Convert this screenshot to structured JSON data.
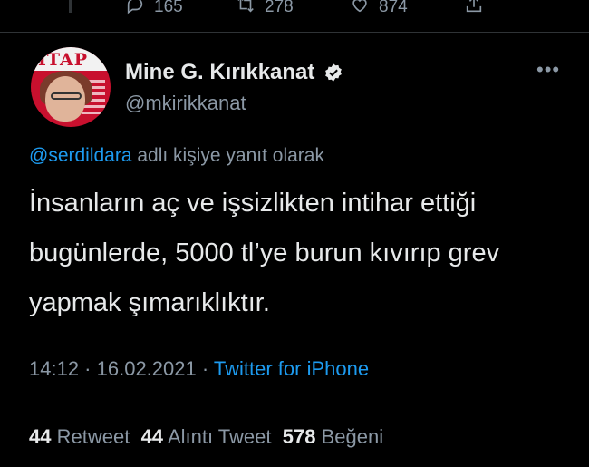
{
  "previous_tweet_actions": {
    "replies": "165",
    "retweets": "278",
    "likes": "874"
  },
  "author": {
    "avatar_banner_text": "ITAP",
    "name": "Mine G. Kırıkkanat",
    "handle": "@mkirikkanat"
  },
  "reply_context": {
    "mention": "@serdildara",
    "suffix": " adlı kişiye yanıt olarak"
  },
  "tweet": {
    "text": "İnsanların aç ve işsizlikten intihar ettiği bugünlerde, 5000 tl’ye burun kıvırıp grev yapmak şımarıklıktır.",
    "time": "14:12",
    "date": "16.02.2021",
    "separator": " · ",
    "source": "Twitter for iPhone"
  },
  "stats": {
    "retweet_count": "44",
    "retweet_label": "Retweet",
    "quote_count": "44",
    "quote_label": "Alıntı Tweet",
    "like_count": "578",
    "like_label": "Beğeni"
  },
  "colors": {
    "background": "#000000",
    "text": "#e7e9ea",
    "secondary": "#8b98a5",
    "link": "#1d9bf0",
    "verified_badge": "#e7e9ea"
  },
  "icons": [
    "reply-icon",
    "retweet-icon",
    "like-icon",
    "share-icon",
    "verified-icon",
    "more-icon"
  ]
}
